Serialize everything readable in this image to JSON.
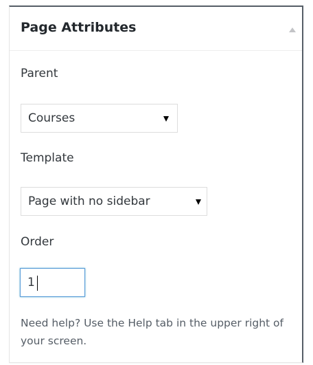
{
  "panel": {
    "title": "Page Attributes",
    "toggle_icon": "arrow-up-icon"
  },
  "parent": {
    "label": "Parent",
    "selected": "Courses"
  },
  "template": {
    "label": "Template",
    "selected": "Page with no sidebar"
  },
  "order": {
    "label": "Order",
    "value": "1"
  },
  "help_text": "Need help? Use the Help tab in the upper right of your screen."
}
